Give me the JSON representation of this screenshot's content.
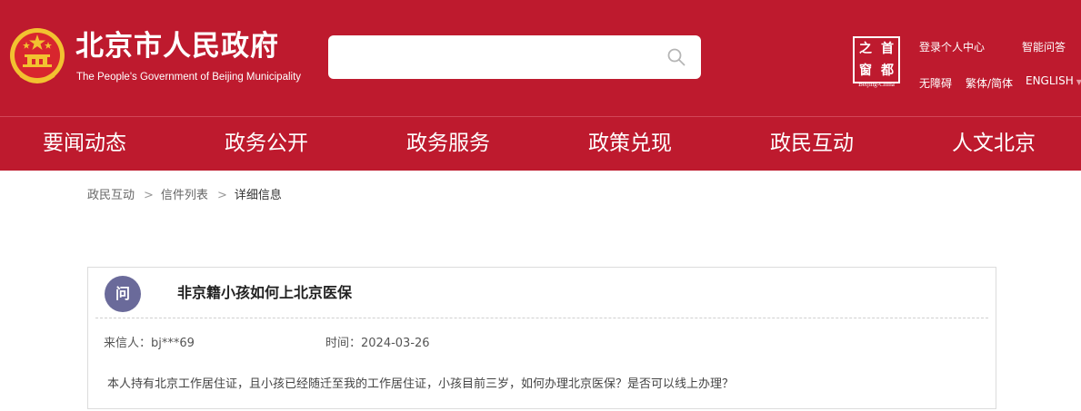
{
  "header": {
    "site_title": "北京市人民政府",
    "site_subtitle": "The People's Government of Beijing Municipality",
    "search": {
      "placeholder": ""
    },
    "seal": {
      "chars": [
        "之",
        "首",
        "窗",
        "都"
      ],
      "caption": "Beijing-China"
    },
    "links": {
      "login": "登录个人中心",
      "smart_qa": "智能问答",
      "accessibility": "无障碍",
      "traditional": "繁体/简体",
      "english": "ENGLISH"
    }
  },
  "nav": {
    "items": [
      {
        "label": "要闻动态"
      },
      {
        "label": "政务公开"
      },
      {
        "label": "政务服务"
      },
      {
        "label": "政策兑现"
      },
      {
        "label": "政民互动"
      },
      {
        "label": "人文北京"
      }
    ]
  },
  "breadcrumb": {
    "items": [
      "政民互动",
      "信件列表"
    ],
    "current": "详细信息",
    "separator": ">"
  },
  "letter": {
    "badge": "问",
    "title": "非京籍小孩如何上北京医保",
    "sender": "来信人：bj***69",
    "date": "时间：2024-03-26",
    "body": "本人持有北京工作居住证，且小孩已经随迁至我的工作居住证，小孩目前三岁，如何办理北京医保？是否可以线上办理？"
  },
  "colors": {
    "brand_red": "#be1a2e",
    "badge_purple": "#6a6a9a",
    "emblem_gold": "#f2c230"
  }
}
